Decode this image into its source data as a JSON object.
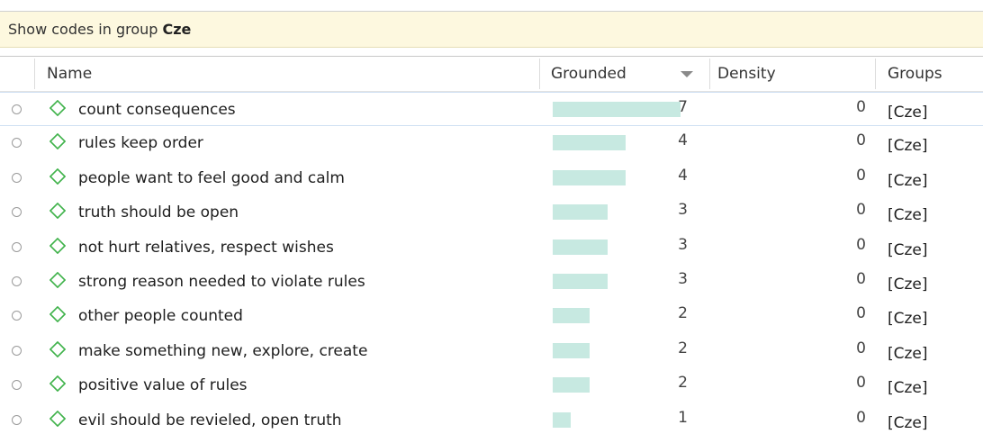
{
  "filter": {
    "prefix": "Show codes in group ",
    "group": "Cze"
  },
  "columns": {
    "name": "Name",
    "grounded": "Grounded",
    "density": "Density",
    "groups": "Groups"
  },
  "colors": {
    "bar": "#c7e9e1",
    "code_icon": "#3fb24a",
    "banner": "#fdf8df"
  },
  "rows": [
    {
      "name": "count consequences",
      "grounded": 7,
      "density": 0,
      "groups": "[Cze]"
    },
    {
      "name": "rules keep order",
      "grounded": 4,
      "density": 0,
      "groups": "[Cze]"
    },
    {
      "name": "people want to feel good and calm",
      "grounded": 4,
      "density": 0,
      "groups": "[Cze]"
    },
    {
      "name": "truth should be open",
      "grounded": 3,
      "density": 0,
      "groups": "[Cze]"
    },
    {
      "name": "not hurt relatives, respect wishes",
      "grounded": 3,
      "density": 0,
      "groups": "[Cze]"
    },
    {
      "name": "strong reason needed to violate rules",
      "grounded": 3,
      "density": 0,
      "groups": "[Cze]"
    },
    {
      "name": "other people counted",
      "grounded": 2,
      "density": 0,
      "groups": "[Cze]"
    },
    {
      "name": "make something new, explore, create",
      "grounded": 2,
      "density": 0,
      "groups": "[Cze]"
    },
    {
      "name": "positive value of rules",
      "grounded": 2,
      "density": 0,
      "groups": "[Cze]"
    },
    {
      "name": "evil should be revieled, open truth",
      "grounded": 1,
      "density": 0,
      "groups": "[Cze]"
    }
  ]
}
